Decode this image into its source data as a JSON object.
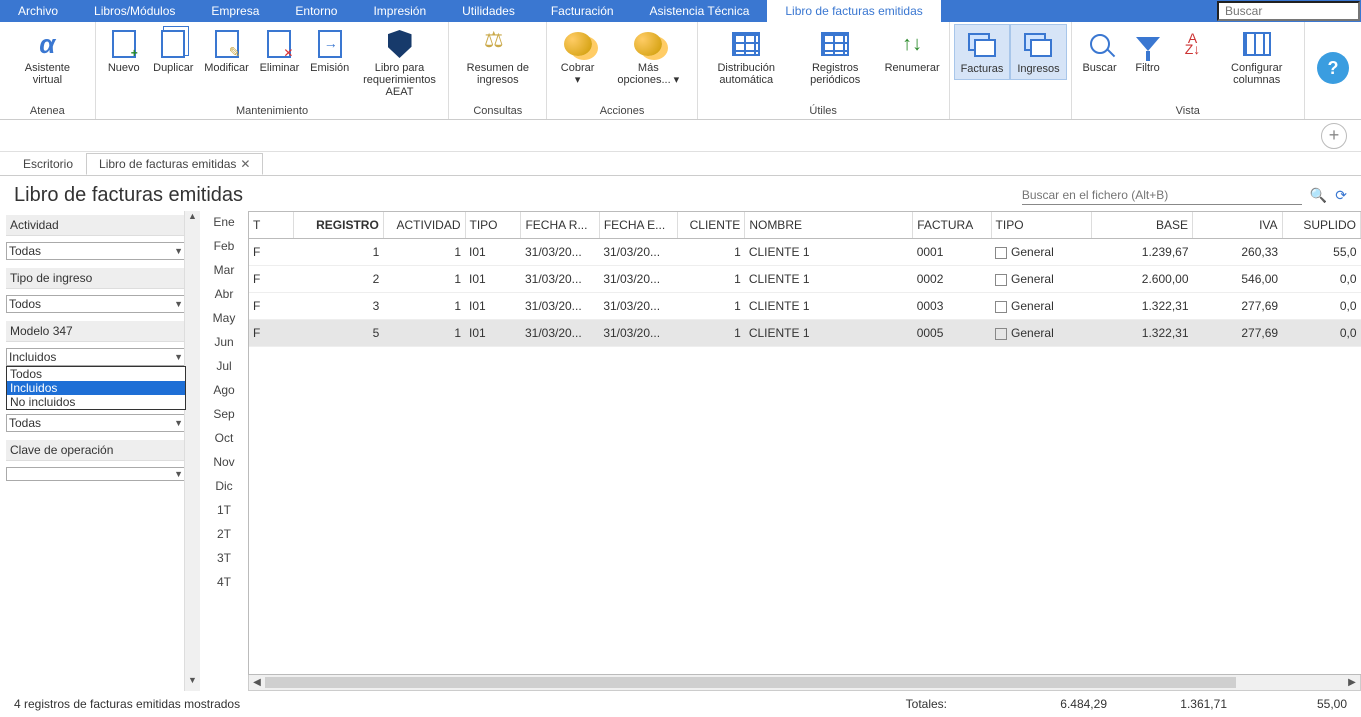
{
  "menubar": {
    "items": [
      "Archivo",
      "Libros/Módulos",
      "Empresa",
      "Entorno",
      "Impresión",
      "Utilidades",
      "Facturación",
      "Asistencia Técnica",
      "Libro de facturas emitidas"
    ],
    "active_index": 8,
    "search_placeholder": "Buscar"
  },
  "ribbon": {
    "groups": [
      {
        "label": "Atenea",
        "buttons": [
          {
            "text": "Asistente\nvirtual",
            "name": "asistente-virtual-button"
          }
        ]
      },
      {
        "label": "Mantenimiento",
        "buttons": [
          {
            "text": "Nuevo",
            "name": "nuevo-button"
          },
          {
            "text": "Duplicar",
            "name": "duplicar-button"
          },
          {
            "text": "Modificar",
            "name": "modificar-button"
          },
          {
            "text": "Eliminar",
            "name": "eliminar-button"
          },
          {
            "text": "Emisión",
            "name": "emision-button"
          },
          {
            "text": "Libro para\nrequerimientos AEAT",
            "name": "libro-aeat-button"
          }
        ]
      },
      {
        "label": "Consultas",
        "buttons": [
          {
            "text": "Resumen\nde ingresos",
            "name": "resumen-ingresos-button"
          }
        ]
      },
      {
        "label": "Acciones",
        "buttons": [
          {
            "text": "Cobrar ▾",
            "name": "cobrar-button"
          },
          {
            "text": "Más\nopciones... ▾",
            "name": "mas-opciones-button"
          }
        ]
      },
      {
        "label": "Útiles",
        "buttons": [
          {
            "text": "Distribución\nautomática",
            "name": "distribucion-button"
          },
          {
            "text": "Registros\nperiódicos",
            "name": "registros-periodicos-button"
          },
          {
            "text": "Renumerar",
            "name": "renumerar-button"
          }
        ]
      },
      {
        "label": "",
        "buttons": [
          {
            "text": "Facturas",
            "name": "facturas-button",
            "active": true
          },
          {
            "text": "Ingresos",
            "name": "ingresos-button",
            "active": true
          }
        ]
      },
      {
        "label": "Vista",
        "buttons": [
          {
            "text": "Buscar",
            "name": "buscar-button"
          },
          {
            "text": "Filtro",
            "name": "filtro-button"
          },
          {
            "text": "",
            "name": "ordenar-button"
          },
          {
            "text": "Configurar\ncolumnas",
            "name": "configurar-columnas-button"
          }
        ]
      }
    ]
  },
  "doc_tabs": {
    "items": [
      {
        "label": "Escritorio",
        "active": false
      },
      {
        "label": "Libro de facturas emitidas",
        "active": true,
        "closable": true
      }
    ]
  },
  "page_title": "Libro de facturas emitidas",
  "file_search_placeholder": "Buscar en el fichero (Alt+B)",
  "sidebar": {
    "filters": [
      {
        "label": "Actividad",
        "value": "Todas"
      },
      {
        "label": "Tipo de ingreso",
        "value": "Todos"
      },
      {
        "label": "Modelo 347",
        "value": "Incluidos",
        "dropdown_open": true,
        "options": [
          "Todos",
          "Incluidos",
          "No incluidos"
        ],
        "selected_index": 1
      },
      {
        "label": "",
        "value": "Todas"
      },
      {
        "label": "Clave de operación",
        "value": ""
      }
    ]
  },
  "months": [
    "Ene",
    "Feb",
    "Mar",
    "Abr",
    "May",
    "Jun",
    "Jul",
    "Ago",
    "Sep",
    "Oct",
    "Nov",
    "Dic",
    "1T",
    "2T",
    "3T",
    "4T"
  ],
  "grid": {
    "columns": [
      "T",
      "REGISTRO",
      "ACTIVIDAD",
      "TIPO",
      "FECHA R...",
      "FECHA E...",
      "CLIENTE",
      "NOMBRE",
      "FACTURA",
      "TIPO",
      "BASE",
      "IVA",
      "SUPLIDO"
    ],
    "sorted_col_index": 1,
    "rows": [
      {
        "t": "F",
        "registro": "1",
        "actividad": "1",
        "tipo": "I01",
        "fecha_r": "31/03/20...",
        "fecha_e": "31/03/20...",
        "cliente": "1",
        "nombre": "CLIENTE 1",
        "factura": "0001",
        "tipo2": "General",
        "base": "1.239,67",
        "iva": "260,33",
        "suplido": "55,0"
      },
      {
        "t": "F",
        "registro": "2",
        "actividad": "1",
        "tipo": "I01",
        "fecha_r": "31/03/20...",
        "fecha_e": "31/03/20...",
        "cliente": "1",
        "nombre": "CLIENTE 1",
        "factura": "0002",
        "tipo2": "General",
        "base": "2.600,00",
        "iva": "546,00",
        "suplido": "0,0"
      },
      {
        "t": "F",
        "registro": "3",
        "actividad": "1",
        "tipo": "I01",
        "fecha_r": "31/03/20...",
        "fecha_e": "31/03/20...",
        "cliente": "1",
        "nombre": "CLIENTE 1",
        "factura": "0003",
        "tipo2": "General",
        "base": "1.322,31",
        "iva": "277,69",
        "suplido": "0,0"
      },
      {
        "t": "F",
        "registro": "5",
        "actividad": "1",
        "tipo": "I01",
        "fecha_r": "31/03/20...",
        "fecha_e": "31/03/20...",
        "cliente": "1",
        "nombre": "CLIENTE 1",
        "factura": "0005",
        "tipo2": "General",
        "base": "1.322,31",
        "iva": "277,69",
        "suplido": "0,0",
        "selected": true
      }
    ]
  },
  "footer": {
    "status": "4 registros de facturas emitidas mostrados",
    "totales_label": "Totales:",
    "base": "6.484,29",
    "iva": "1.361,71",
    "suplido": "55,00"
  }
}
